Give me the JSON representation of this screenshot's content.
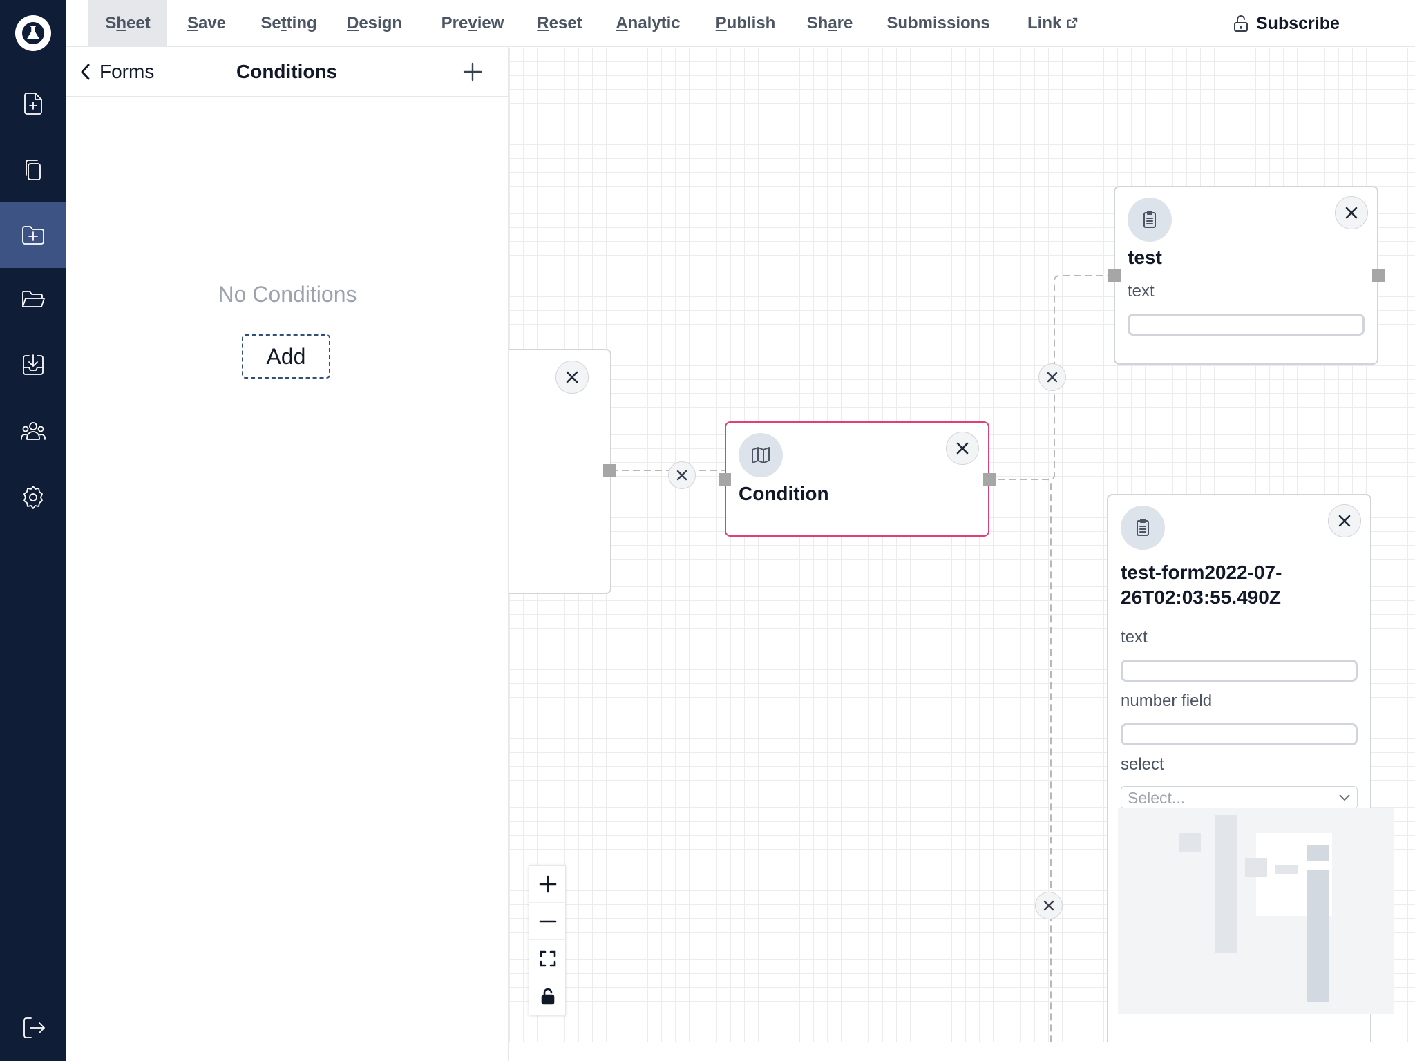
{
  "sidebar": {
    "items": [
      {
        "icon": "file-plus-icon"
      },
      {
        "icon": "copy-icon"
      },
      {
        "icon": "folder-plus-icon",
        "active": true
      },
      {
        "icon": "folder-open-icon"
      },
      {
        "icon": "inbox-download-icon"
      },
      {
        "icon": "users-icon"
      },
      {
        "icon": "gear-icon"
      },
      {
        "icon": "logout-icon"
      }
    ]
  },
  "topbar": {
    "menu": [
      {
        "label": "Sheet",
        "key": "h",
        "active": true
      },
      {
        "label": "Save",
        "key": "S"
      },
      {
        "label": "Setting",
        "key": "t"
      },
      {
        "label": "Design",
        "key": "D"
      },
      {
        "label": "Preview",
        "key": "v"
      },
      {
        "label": "Reset",
        "key": "R"
      },
      {
        "label": "Analytic",
        "key": "A"
      },
      {
        "label": "Publish",
        "key": "P"
      },
      {
        "label": "Share",
        "key": "a"
      },
      {
        "label": "Submissions",
        "key": ""
      },
      {
        "label": "Link",
        "key": ""
      }
    ],
    "subscribe_label": "Subscribe"
  },
  "panel": {
    "back_label": "Forms",
    "title": "Conditions",
    "empty_text": "No Conditions",
    "add_label": "Add"
  },
  "flow": {
    "condition_node": {
      "title": "Condition"
    },
    "test_node": {
      "title": "test",
      "fields": [
        {
          "label": "text",
          "type": "input"
        }
      ]
    },
    "form_node": {
      "title_line1": "test-form2022-07-",
      "title_line2": "26T02:03:55.490Z",
      "fields": [
        {
          "label": "text",
          "type": "input"
        },
        {
          "label": "number field",
          "type": "input"
        },
        {
          "label": "select",
          "type": "select",
          "placeholder": "Select..."
        }
      ]
    }
  },
  "colors": {
    "sidebar_bg": "#0f1d36",
    "sidebar_active": "#3c5384",
    "selected_border": "#e0407a"
  }
}
